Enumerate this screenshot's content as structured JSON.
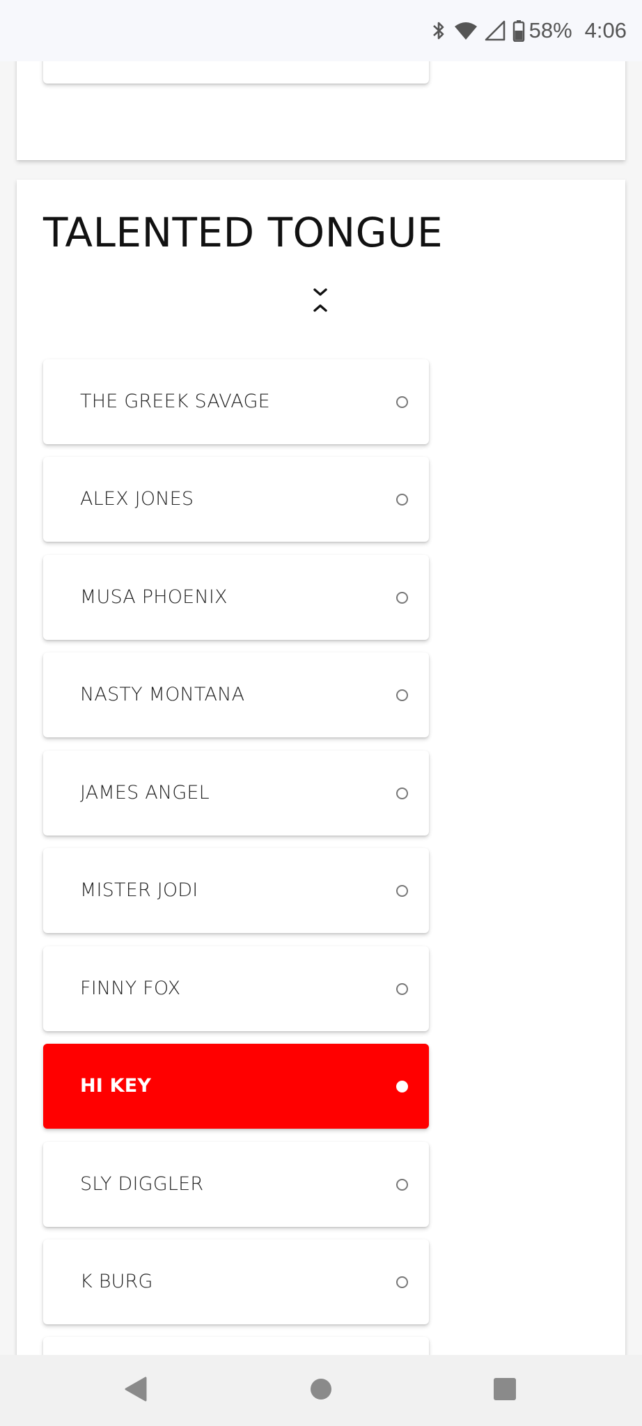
{
  "status_bar": {
    "battery_percent": "58%",
    "time": "4:06",
    "icons": [
      "bluetooth-icon",
      "wifi-icon",
      "signal-icon",
      "battery-icon"
    ]
  },
  "section": {
    "title": "TALENTED TONGUE",
    "toggle_icon": "collapse-chevrons-icon",
    "selected_index": 7,
    "options": [
      {
        "label": "THE GREEK SAVAGE",
        "selected": false
      },
      {
        "label": "ALEX JONES",
        "selected": false
      },
      {
        "label": "MUSA PHOENIX",
        "selected": false
      },
      {
        "label": "NASTY MONTANA",
        "selected": false
      },
      {
        "label": "JAMES ANGEL",
        "selected": false
      },
      {
        "label": "MISTER JODI",
        "selected": false
      },
      {
        "label": "FINNY FOX",
        "selected": false
      },
      {
        "label": "HI KEY",
        "selected": true
      },
      {
        "label": "SLY DIGGLER",
        "selected": false
      },
      {
        "label": "K BURG",
        "selected": false
      },
      {
        "label": "",
        "selected": false
      }
    ]
  },
  "colors": {
    "selected_bg": "#ff0000",
    "selected_text": "#ffffff",
    "card_bg": "#ffffff",
    "page_bg": "#f6f6f6"
  },
  "nav_bar": {
    "buttons": [
      "back-icon",
      "home-icon",
      "recents-icon"
    ]
  }
}
